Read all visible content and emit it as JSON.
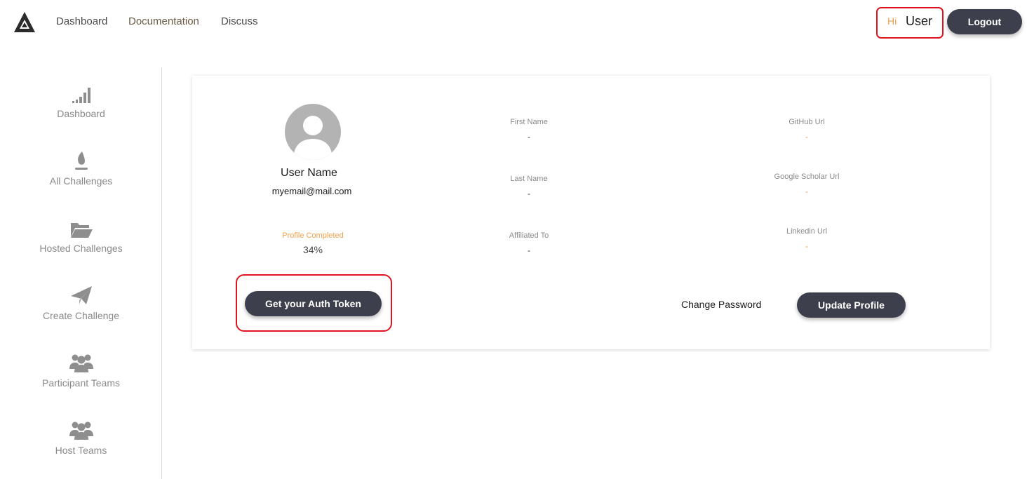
{
  "nav": {
    "links": [
      "Dashboard",
      "Documentation",
      "Discuss"
    ],
    "hi": "Hi",
    "user": "User",
    "logout": "Logout"
  },
  "sidebar": {
    "items": [
      {
        "label": "Dashboard",
        "icon": "signal-bars-icon"
      },
      {
        "label": "All Challenges",
        "icon": "flame-icon"
      },
      {
        "label": "Hosted Challenges",
        "icon": "folder-open-icon"
      },
      {
        "label": "Create Challenge",
        "icon": "paper-plane-icon"
      },
      {
        "label": "Participant Teams",
        "icon": "users-icon"
      },
      {
        "label": "Host Teams",
        "icon": "users-icon"
      }
    ]
  },
  "profile": {
    "name": "User Name",
    "email": "myemail@mail.com",
    "completed_label": "Profile Completed",
    "completed_value": "34%",
    "first_name_label": "First Name",
    "first_name": "-",
    "last_name_label": "Last Name",
    "last_name": "-",
    "affiliated_label": "Affiliated To",
    "affiliated": "-",
    "github_label": "GitHub Url",
    "github": "-",
    "scholar_label": "Google Scholar Url",
    "scholar": "-",
    "linkedin_label": "Linkedin Url",
    "linkedin": "-",
    "auth_button": "Get your Auth Token",
    "change_password": "Change Password",
    "update_button": "Update Profile"
  },
  "colors": {
    "accent": "#f0a04a",
    "button": "#3d3f4c",
    "highlight": "#e0141f"
  }
}
